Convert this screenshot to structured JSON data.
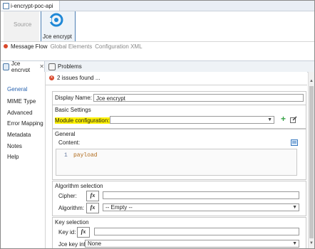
{
  "editor": {
    "tab_title": "i-encrypt-poc-api"
  },
  "canvas": {
    "source_label": "Source",
    "component_label": "Jce encrypt"
  },
  "subtabs": {
    "message_flow": "Message Flow",
    "global_elements": "Global Elements",
    "configuration_xml": "Configuration XML"
  },
  "props": {
    "tab_label": "Jce encrypt",
    "problems_label": "Problems",
    "issues_text": "2 issues found ..."
  },
  "nav": [
    "General",
    "MIME Type",
    "Advanced",
    "Error Mapping",
    "Metadata",
    "Notes",
    "Help"
  ],
  "form": {
    "display_name_label": "Display Name:",
    "display_name_value": "Jce encrypt",
    "basic_settings_title": "Basic Settings",
    "module_config_label": "Module configuration:",
    "module_config_value": "",
    "general_title": "General",
    "content_label": "Content:",
    "content_line_number": "1",
    "content_text": "payload",
    "algorithm_selection_title": "Algorithm selection",
    "cipher_label": "Cipher:",
    "algorithm_label": "Algorithm:",
    "algorithm_value": "-- Empty --",
    "key_selection_title": "Key selection",
    "key_id_label": "Key id:",
    "jce_key_info_label": "Jce key info",
    "jce_key_info_value": "None",
    "fx_label": "fx"
  },
  "colors": {
    "accent": "#2a64b0",
    "highlight": "#fff200",
    "error": "#d9482b",
    "add_green": "#3aa34a"
  }
}
